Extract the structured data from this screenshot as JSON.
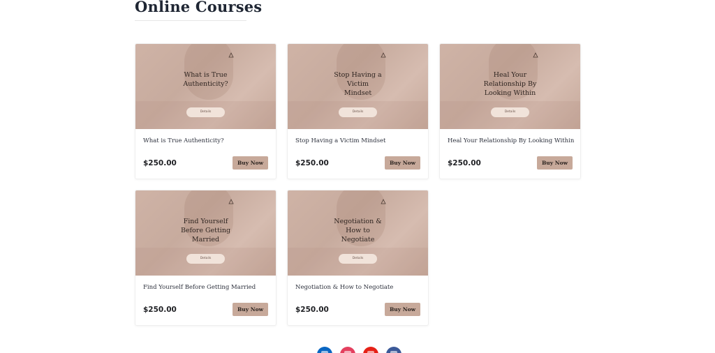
{
  "section": {
    "title": "Online Courses"
  },
  "courses": [
    {
      "thumb_title_lines": [
        "What is True",
        "Authenticity?"
      ],
      "thumb_button": "Details",
      "name": "What is True Authenticity?",
      "price": "$250.00",
      "buy_label": "Buy Now"
    },
    {
      "thumb_title_lines": [
        "Stop Having a",
        "Victim",
        "Mindset"
      ],
      "thumb_button": "Details",
      "name": "Stop Having a Victim Mindset",
      "price": "$250.00",
      "buy_label": "Buy Now"
    },
    {
      "thumb_title_lines": [
        "Heal Your",
        "Relationship By",
        "Looking Within"
      ],
      "thumb_button": "Details",
      "name": "Heal Your Relationship By Looking Within",
      "price": "$250.00",
      "buy_label": "Buy Now"
    },
    {
      "thumb_title_lines": [
        "Find Yourself",
        "Before Getting",
        "Married"
      ],
      "thumb_button": "Details",
      "name": "Find Yourself Before Getting Married",
      "price": "$250.00",
      "buy_label": "Buy Now"
    },
    {
      "thumb_title_lines": [
        "Negotiation &",
        "How to",
        "Negotiate"
      ],
      "thumb_button": "Details",
      "name": "Negotiation & How to Negotiate",
      "price": "$250.00",
      "buy_label": "Buy Now"
    }
  ],
  "social": [
    {
      "icon": "linkedin-icon",
      "color": "#0a66c2"
    },
    {
      "icon": "instagram-icon",
      "color": "#e4405f"
    },
    {
      "icon": "youtube-icon",
      "color": "#e62117"
    },
    {
      "icon": "facebook-icon",
      "color": "#3b5998"
    }
  ],
  "colors": {
    "accent": "#c7a99a",
    "thumb": "#cfb3a6",
    "heading": "#1f2633"
  }
}
